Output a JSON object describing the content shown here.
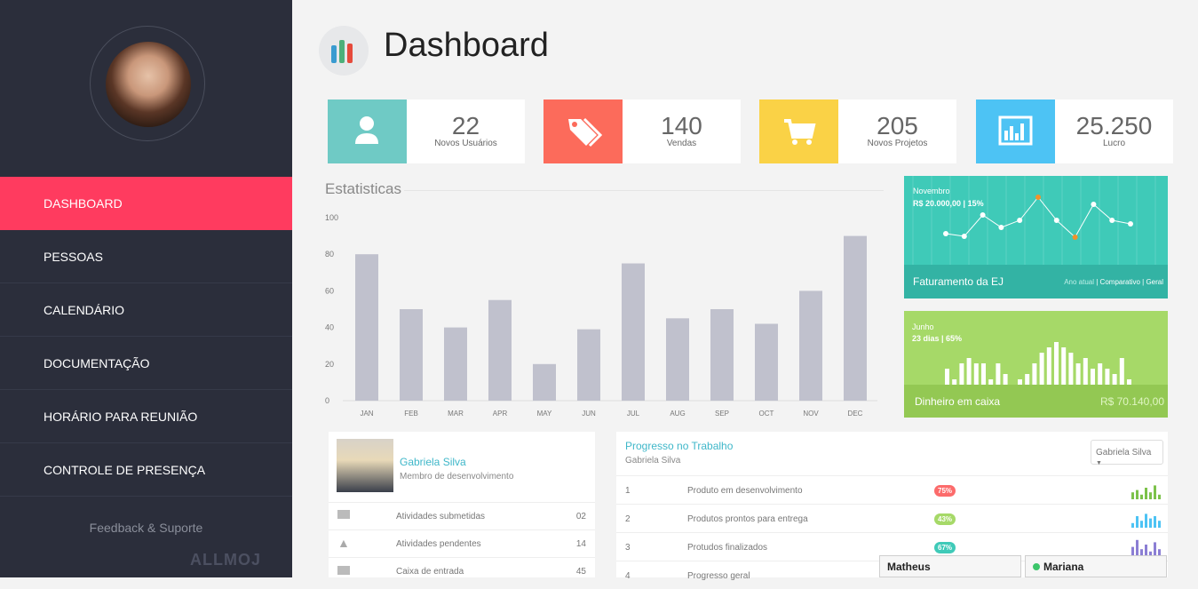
{
  "nav": {
    "items": [
      {
        "label": "DASHBOARD"
      },
      {
        "label": "PESSOAS"
      },
      {
        "label": "CALENDÁRIO"
      },
      {
        "label": "DOCUMENTAÇÃO"
      },
      {
        "label": "HORÁRIO PARA REUNIÃO"
      },
      {
        "label": "CONTROLE DE PRESENÇA"
      }
    ]
  },
  "sidebar": {
    "feedback": "Feedback & Suporte",
    "logo": "ALLMOJ"
  },
  "header": {
    "title": "Dashboard"
  },
  "cards": [
    {
      "value": "22",
      "label": "Novos Usuários",
      "color": "#6fcac5",
      "icon": "user-icon"
    },
    {
      "value": "140",
      "label": "Vendas",
      "color": "#fc6b5b",
      "icon": "tags-icon"
    },
    {
      "value": "205",
      "label": "Novos Projetos",
      "color": "#fad246",
      "icon": "cart-icon"
    },
    {
      "value": "25.250",
      "label": "Lucro",
      "color": "#4dc3f4",
      "icon": "bar-chart-icon"
    }
  ],
  "stats": {
    "title": "Estatisticas"
  },
  "chart_data": {
    "type": "bar",
    "categories": [
      "JAN",
      "FEB",
      "MAR",
      "APR",
      "MAY",
      "JUN",
      "JUL",
      "AUG",
      "SEP",
      "OCT",
      "NOV",
      "DEC"
    ],
    "values": [
      80,
      50,
      40,
      55,
      20,
      39,
      75,
      45,
      50,
      42,
      60,
      90
    ],
    "yticks": [
      0,
      20,
      40,
      60,
      80,
      100
    ],
    "ylim": [
      0,
      100
    ],
    "color": "#c0c1cd"
  },
  "revenue": {
    "month": "Novembro",
    "detail": "R$ 20.000,00 | 15%",
    "title": "Faturamento da EJ",
    "tabs": [
      "Ano atual",
      "Comparativo",
      "Geral"
    ],
    "line": [
      3.5,
      3.2,
      5.6,
      4.2,
      5.0,
      7.6,
      5.0,
      3.1,
      6.8,
      5.0,
      4.6
    ],
    "highlight": [
      5,
      7
    ]
  },
  "cash": {
    "month": "Junho",
    "detail": "23 dias | 65%",
    "title": "Dinheiro em caixa",
    "value": "R$ 70.140,00",
    "bars": [
      3,
      1,
      4,
      5,
      4,
      4,
      1,
      4,
      2,
      0,
      1,
      2,
      4,
      6,
      7,
      8,
      7,
      6,
      4,
      5,
      3,
      4,
      3,
      2,
      5,
      1
    ]
  },
  "profile": {
    "name": "Gabriela Silva",
    "role": "Membro de desenvolvimento",
    "rows": [
      {
        "icon": "card-icon",
        "label": "Atividades submetidas",
        "count": "02"
      },
      {
        "icon": "warning-icon",
        "label": "Atividades pendentes",
        "count": "14"
      },
      {
        "icon": "envelope-icon",
        "label": "Caixa de entrada",
        "count": "45"
      }
    ]
  },
  "progress": {
    "title": "Progresso no Trabalho",
    "subtitle": "Gabriela Silva",
    "select": "Gabriela Silva",
    "rows": [
      {
        "n": "1",
        "label": "Produto em desenvolvimento",
        "pct": "75%",
        "color": "#fc6b6b",
        "spark": "#7cc24a"
      },
      {
        "n": "2",
        "label": "Produtos prontos para entrega",
        "pct": "43%",
        "color": "#a6d968",
        "spark": "#4dc3f4"
      },
      {
        "n": "3",
        "label": "Protudos finalizados",
        "pct": "67%",
        "color": "#3fcab8",
        "spark": "#8b7ed4"
      },
      {
        "n": "4",
        "label": "Progresso geral",
        "pct": "",
        "color": "",
        "spark": ""
      }
    ]
  },
  "chat": [
    {
      "name": "Matheus",
      "online": false
    },
    {
      "name": "Mariana",
      "online": true
    }
  ]
}
